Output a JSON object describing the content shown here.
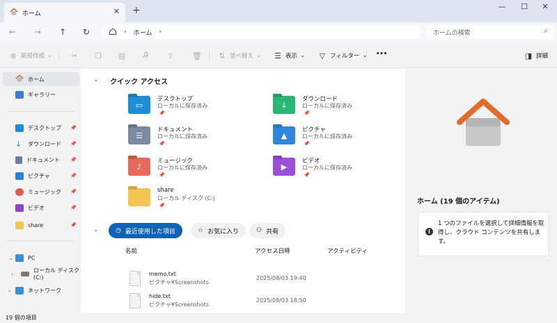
{
  "tab": {
    "title": "ホーム",
    "close": "✕",
    "new_tab": "+"
  },
  "window": {
    "minimize": "—",
    "maximize": "☐",
    "close": "✕"
  },
  "address": {
    "path": [
      "ホーム"
    ],
    "search_placeholder": "ホームの検索"
  },
  "toolbar": {
    "new": "新規作成",
    "sort": "並べ替え",
    "view": "表示",
    "filter": "フィルター",
    "more": "•••",
    "details": "詳細"
  },
  "sidebar": {
    "top": [
      {
        "label": "ホーム",
        "selected": true
      },
      {
        "label": "ギャラリー"
      }
    ],
    "pinned": [
      {
        "label": "デスクトップ",
        "color": "#1e8fd6"
      },
      {
        "label": "ダウンロード",
        "color": "#1aa36b"
      },
      {
        "label": "ドキュメント",
        "color": "#6b7f99"
      },
      {
        "label": "ピクチャ",
        "color": "#2f7fd8"
      },
      {
        "label": "ミュージック",
        "color": "#e0574f"
      },
      {
        "label": "ビデオ",
        "color": "#8e44c7"
      },
      {
        "label": "share",
        "color": "#f2c14e"
      }
    ],
    "drives": [
      {
        "label": "PC"
      },
      {
        "label": "ローカル ディスク (C:)"
      },
      {
        "label": "ネットワーク"
      }
    ]
  },
  "quick_access": {
    "title": "クイック アクセス",
    "items": [
      {
        "name": "デスクトップ",
        "sub": "ローカルに保存済み",
        "color": "#1e8fd6",
        "icon": "desktop-icon"
      },
      {
        "name": "ダウンロード",
        "sub": "ローカルに保存済み",
        "color": "#2bb673",
        "icon": "download-icon"
      },
      {
        "name": "ドキュメント",
        "sub": "ローカルに保存済み",
        "color": "#7a8aa3",
        "icon": "document-icon"
      },
      {
        "name": "ピクチャ",
        "sub": "ローカルに保存済み",
        "color": "#2f87dd",
        "icon": "picture-icon"
      },
      {
        "name": "ミュージック",
        "sub": "ローカルに保存済み",
        "color": "#e36a5c",
        "icon": "music-icon"
      },
      {
        "name": "ビデオ",
        "sub": "ローカルに保存済み",
        "color": "#9b4fd6",
        "icon": "video-icon"
      },
      {
        "name": "share",
        "sub": "ローカル ディスク (C:)",
        "color": "#f5c451",
        "icon": "folder-icon"
      }
    ]
  },
  "recent": {
    "chips": [
      "最近使用した項目",
      "お気に入り",
      "共有"
    ],
    "columns": [
      "名前",
      "アクセス日時",
      "アクティビティ"
    ],
    "files": [
      {
        "name": "memo.txt",
        "path": "ピクチャ¥Screenshots",
        "date": "2025/08/03 19:40"
      },
      {
        "name": "hide.txt",
        "path": "ピクチャ¥Screenshots",
        "date": "2025/08/03 18:50"
      }
    ]
  },
  "details": {
    "title": "ホーム (19 個のアイテム)",
    "info": "1 つのファイルを選択して詳細情報を取得し、クラウド コンテンツを共有します。"
  },
  "status": {
    "count": "19 個の項目"
  }
}
